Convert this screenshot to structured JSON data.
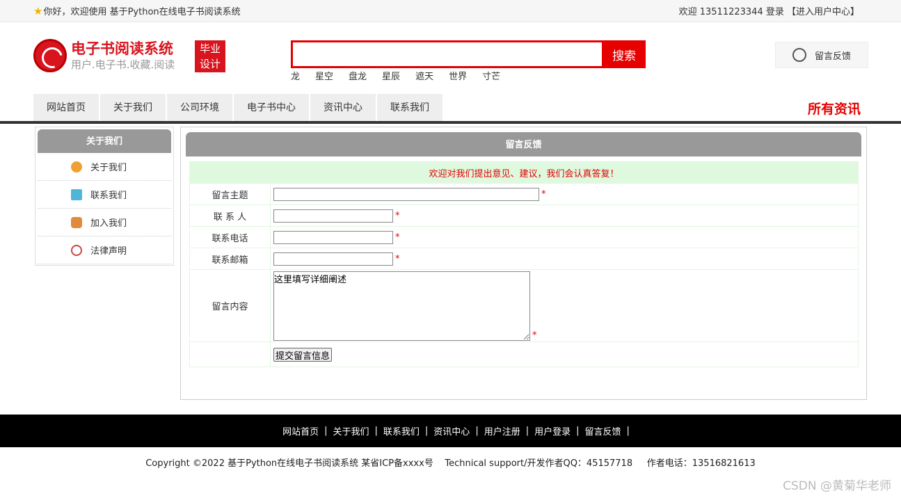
{
  "topbar": {
    "greeting": "你好，欢迎使用 基于Python在线电子书阅读系统",
    "user": "欢迎 13511223344 登录 【进入用户中心】"
  },
  "logo": {
    "title": "电子书阅读系统",
    "subtitle": "用户.电子书.收藏.阅读",
    "badge_line1": "毕业",
    "badge_line2": "设计"
  },
  "search": {
    "button": "搜索",
    "hotwords": [
      "龙",
      "星空",
      "盘龙",
      "星辰",
      "遮天",
      "世界",
      "寸芒"
    ]
  },
  "feedback_link": "留言反馈",
  "nav": {
    "items": [
      "网站首页",
      "关于我们",
      "公司环境",
      "电子书中心",
      "资讯中心",
      "联系我们"
    ],
    "right": "所有资讯"
  },
  "sidebar": {
    "title": "关于我们",
    "items": [
      {
        "label": "关于我们",
        "color": "#f0a030"
      },
      {
        "label": "联系我们",
        "color": "#4fb6d8"
      },
      {
        "label": "加入我们",
        "color": "#e08a3c"
      },
      {
        "label": "法律声明",
        "color": "#c44"
      }
    ]
  },
  "main": {
    "title": "留言反馈",
    "notice": "欢迎对我们提出意见、建议，我们会认真答复！",
    "fields": {
      "subject": "留言主题",
      "contact": "联 系 人",
      "phone": "联系电话",
      "email": "联系邮箱",
      "content": "留言内容"
    },
    "content_value": "这里填写详细阐述",
    "required": "*",
    "submit": "提交留言信息"
  },
  "footer": {
    "links": [
      "网站首页",
      "关于我们",
      "联系我们",
      "资讯中心",
      "用户注册",
      "用户登录",
      "留言反馈"
    ],
    "separator": "|",
    "copyright": "Copyright ©2022 基于Python在线电子书阅读系统 某省ICP备xxxx号    Technical support/开发作者QQ：45157718     作者电话：13516821613"
  },
  "watermark": "CSDN @黄菊华老师"
}
